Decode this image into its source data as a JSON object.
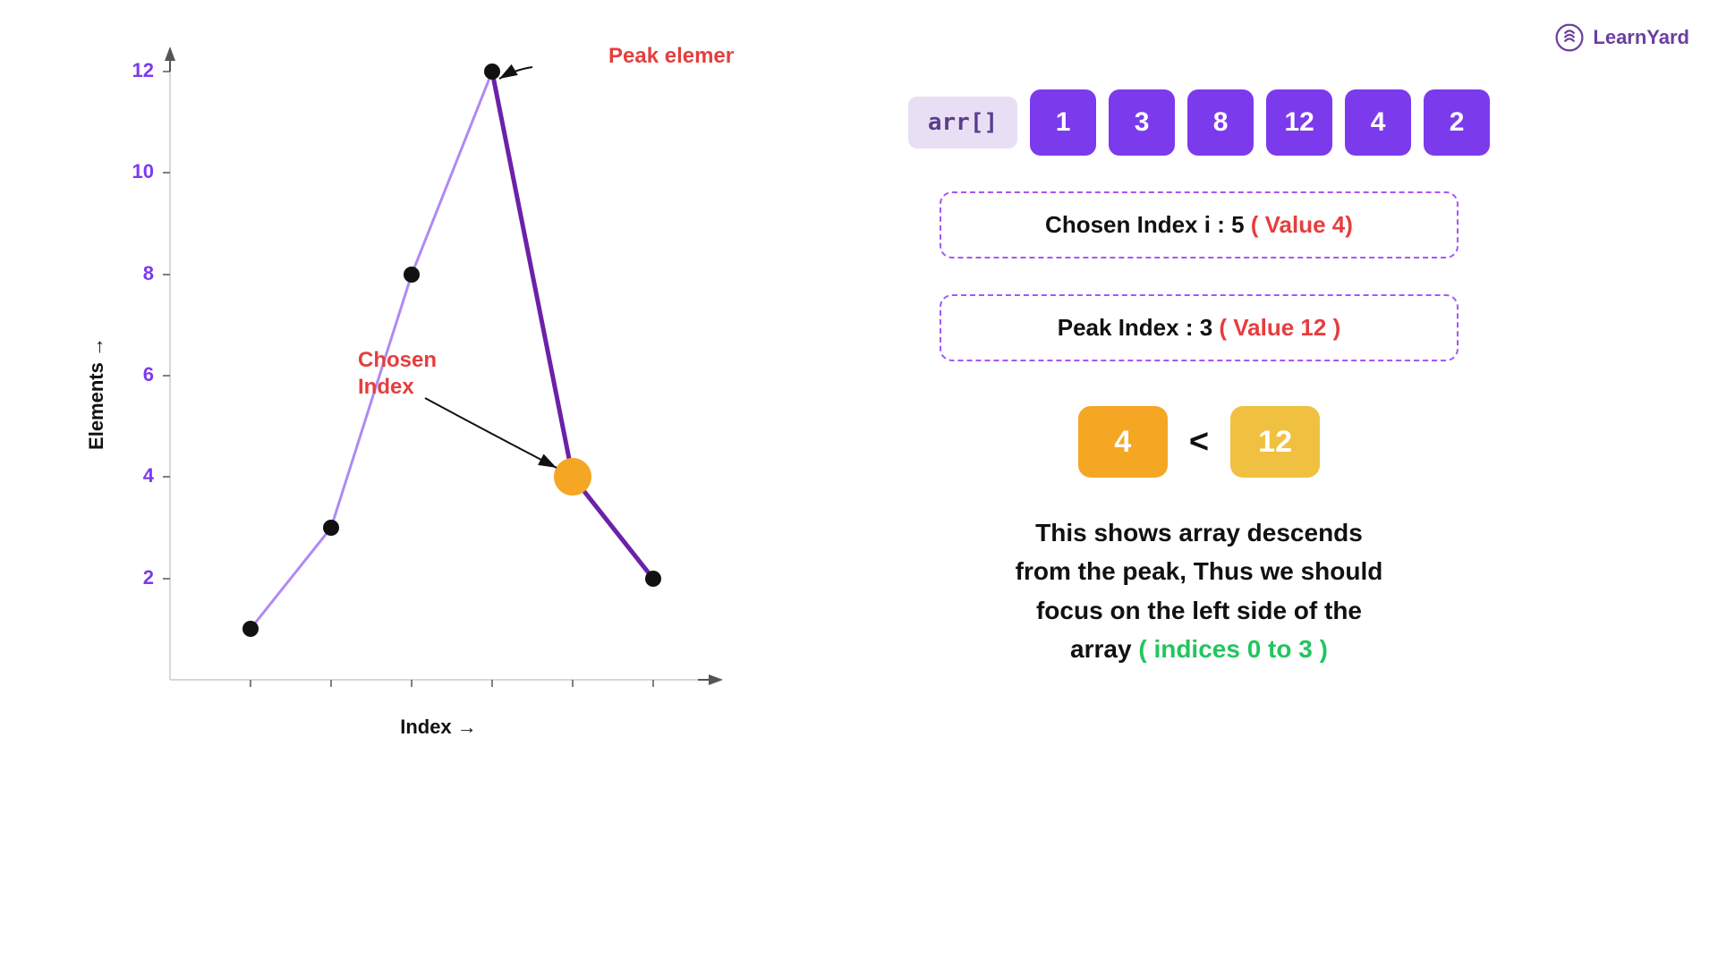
{
  "logo": {
    "text": "LearnYard"
  },
  "array": {
    "label": "arr[]",
    "values": [
      1,
      3,
      8,
      12,
      4,
      2
    ]
  },
  "chosen_index_box": {
    "text_before": "Chosen Index i : 5",
    "text_highlight": " ( Value 4)"
  },
  "peak_index_box": {
    "text_before": "Peak Index : 3",
    "text_highlight": " ( Value 12 )"
  },
  "comparison": {
    "left_value": "4",
    "right_value": "12",
    "operator": "<"
  },
  "description": {
    "line1": "This shows array descends",
    "line2": "from the peak, Thus we should",
    "line3": "focus on the left side of the",
    "line4": "array",
    "highlight": " ( indices 0 to 3 )"
  },
  "chart": {
    "x_label": "Index →",
    "y_label": "Elements →",
    "peak_label": "Peak element",
    "chosen_label": "Chosen\nIndex",
    "y_ticks": [
      2,
      4,
      6,
      8,
      10,
      12
    ],
    "data_points": [
      {
        "index": 0,
        "value": 1
      },
      {
        "index": 1,
        "value": 3
      },
      {
        "index": 2,
        "value": 8
      },
      {
        "index": 3,
        "value": 12
      },
      {
        "index": 4,
        "value": 4
      },
      {
        "index": 5,
        "value": 2
      }
    ]
  }
}
